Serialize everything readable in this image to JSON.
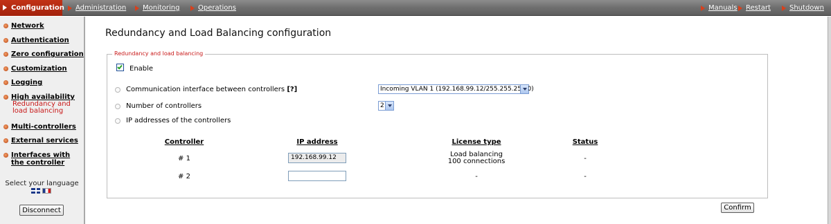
{
  "topnav": {
    "tabs": [
      "Configuration",
      "Administration",
      "Monitoring",
      "Operations"
    ],
    "right": [
      "Manuals",
      "Restart",
      "Shutdown"
    ]
  },
  "sidebar": {
    "items": [
      {
        "label": "Network"
      },
      {
        "label": "Authentication"
      },
      {
        "label": "Zero configuration"
      },
      {
        "label": "Customization"
      },
      {
        "label": "Logging"
      },
      {
        "label": "High availability",
        "sub": "Redundancy and load balancing"
      },
      {
        "label": "Multi-controllers"
      },
      {
        "label": "External services"
      },
      {
        "label": "Interfaces with the controller"
      }
    ],
    "language_label": "Select your language",
    "disconnect_label": "Disconnect"
  },
  "main": {
    "title": "Redundancy and Load Balancing configuration",
    "fieldset_legend": "Redundancy and load balancing",
    "enable_label": "Enable",
    "enable_checked": true,
    "comm_interface_label": "Communication interface between controllers",
    "help_label": "[?]",
    "comm_interface_value": "Incoming VLAN 1 (192.168.99.12/255.255.255.0)",
    "num_controllers_label": "Number of controllers",
    "num_controllers_value": "2",
    "ip_addresses_label": "IP addresses of the controllers",
    "table": {
      "headers": [
        "Controller",
        "IP address",
        "License type",
        "Status"
      ],
      "rows": [
        {
          "controller": "# 1",
          "ip": "192.168.99.12",
          "license_line1": "Load balancing",
          "license_line2": "100 connections",
          "status": "-"
        },
        {
          "controller": "# 2",
          "ip": "",
          "license_line1": "-",
          "license_line2": "",
          "status": "-"
        }
      ]
    },
    "confirm_label": "Confirm"
  }
}
